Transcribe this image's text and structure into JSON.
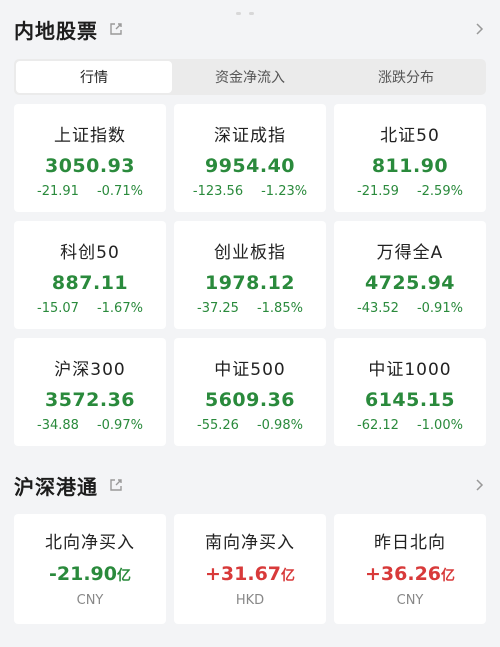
{
  "section1": {
    "title": "内地股票",
    "tabs": [
      "行情",
      "资金净流入",
      "涨跌分布"
    ],
    "active_tab": 0
  },
  "indices": [
    {
      "name": "上证指数",
      "price": "3050.93",
      "change": "-21.91",
      "pct": "-0.71%"
    },
    {
      "name": "深证成指",
      "price": "9954.40",
      "change": "-123.56",
      "pct": "-1.23%"
    },
    {
      "name": "北证50",
      "price": "811.90",
      "change": "-21.59",
      "pct": "-2.59%"
    },
    {
      "name": "科创50",
      "price": "887.11",
      "change": "-15.07",
      "pct": "-1.67%"
    },
    {
      "name": "创业板指",
      "price": "1978.12",
      "change": "-37.25",
      "pct": "-1.85%"
    },
    {
      "name": "万得全A",
      "price": "4725.94",
      "change": "-43.52",
      "pct": "-0.91%"
    },
    {
      "name": "沪深300",
      "price": "3572.36",
      "change": "-34.88",
      "pct": "-0.97%"
    },
    {
      "name": "中证500",
      "price": "5609.36",
      "change": "-55.26",
      "pct": "-0.98%"
    },
    {
      "name": "中证1000",
      "price": "6145.15",
      "change": "-62.12",
      "pct": "-1.00%"
    }
  ],
  "section2": {
    "title": "沪深港通",
    "items": [
      {
        "name": "北向净买入",
        "value": "-21.90",
        "unit": "亿",
        "currency": "CNY",
        "trend": "down"
      },
      {
        "name": "南向净买入",
        "value": "+31.67",
        "unit": "亿",
        "currency": "HKD",
        "trend": "up"
      },
      {
        "name": "昨日北向",
        "value": "+36.26",
        "unit": "亿",
        "currency": "CNY",
        "trend": "up"
      }
    ]
  },
  "colors": {
    "down": "#2a8a3c",
    "up": "#d83a3a"
  },
  "icons": {
    "external": "external-link-icon",
    "more": "chevron-right-icon"
  }
}
